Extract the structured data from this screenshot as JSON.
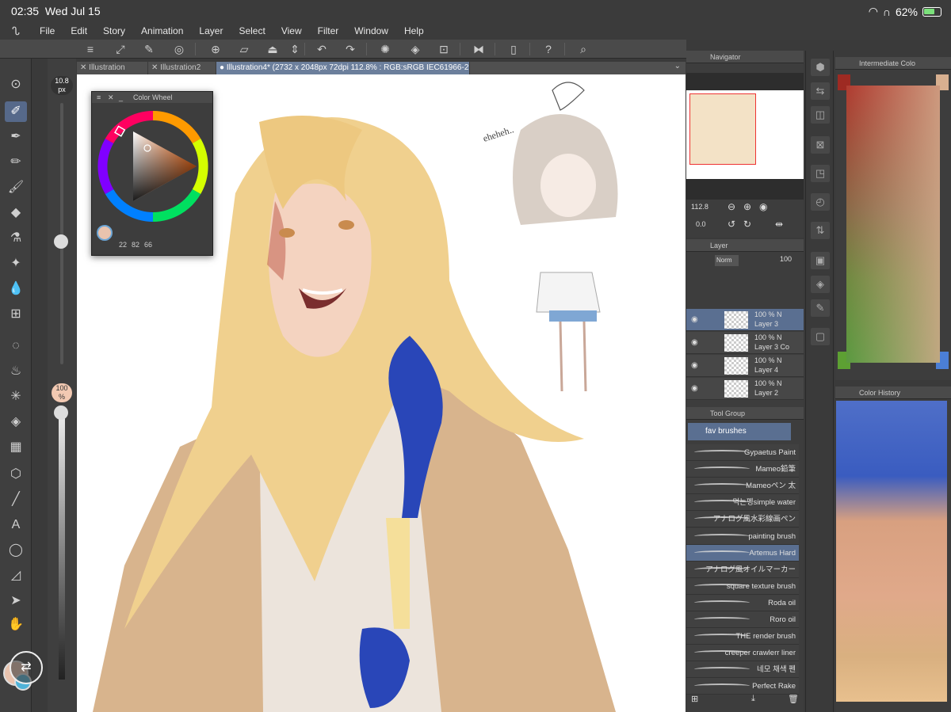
{
  "status": {
    "time": "02:35",
    "date": "Wed Jul 15",
    "battery": "62%"
  },
  "menu": [
    "File",
    "Edit",
    "Story",
    "Animation",
    "Layer",
    "Select",
    "View",
    "Filter",
    "Window",
    "Help"
  ],
  "tabs": [
    {
      "label": "Illustration"
    },
    {
      "label": "Illustration2"
    },
    {
      "label": "Illustration4* (2732 x 2048px 72dpi 112.8% : RGB:sRGB IEC61966-2.1)"
    }
  ],
  "brush_size": {
    "value": "10.8",
    "unit": "px"
  },
  "opacity_badge": {
    "value": "100",
    "unit": "%"
  },
  "color_wheel": {
    "title": "Color Wheel",
    "h": "22",
    "s": "82",
    "v": "66"
  },
  "canvas": {
    "sketch_text": "eheheh.."
  },
  "navigator": {
    "title": "Navigator",
    "zoom": "112.8",
    "rotation": "0.0"
  },
  "layer_panel": {
    "title": "Layer",
    "blend_mode": "Norm",
    "opacity": "100",
    "layers": [
      {
        "opacity": "100 %",
        "mode": "N",
        "name": "Layer 3",
        "selected": true
      },
      {
        "opacity": "100 %",
        "mode": "N",
        "name": "Layer 3 Co",
        "selected": false
      },
      {
        "opacity": "100 %",
        "mode": "N",
        "name": "Layer 4",
        "selected": false
      },
      {
        "opacity": "100 %",
        "mode": "N",
        "name": "Layer 2",
        "selected": false
      }
    ]
  },
  "tool_group": {
    "title": "Tool Group",
    "group": "fav brushes",
    "brushes": [
      "Gypaetus Paint",
      "Mameo鉛筆",
      "Mameoペン 太",
      "먹는펭simple water",
      "アナログ風水彩線画ペン",
      "painting brush",
      "Artemus Hard",
      "アナログ風オイルマーカー",
      "square texture brush",
      "Roda oil",
      "Roro oil",
      "THE render brush",
      "creeper crawlerr liner",
      "네모 채색 펜",
      "Perfect Rake"
    ],
    "selected_index": 6
  },
  "intermediate_color": {
    "title": "Intermediate Colo"
  },
  "color_history": {
    "title": "Color History"
  },
  "colors": {
    "accent": "#5a6f91",
    "main_color": "#e9c3ae",
    "sub_color": "#4fb3d9"
  }
}
